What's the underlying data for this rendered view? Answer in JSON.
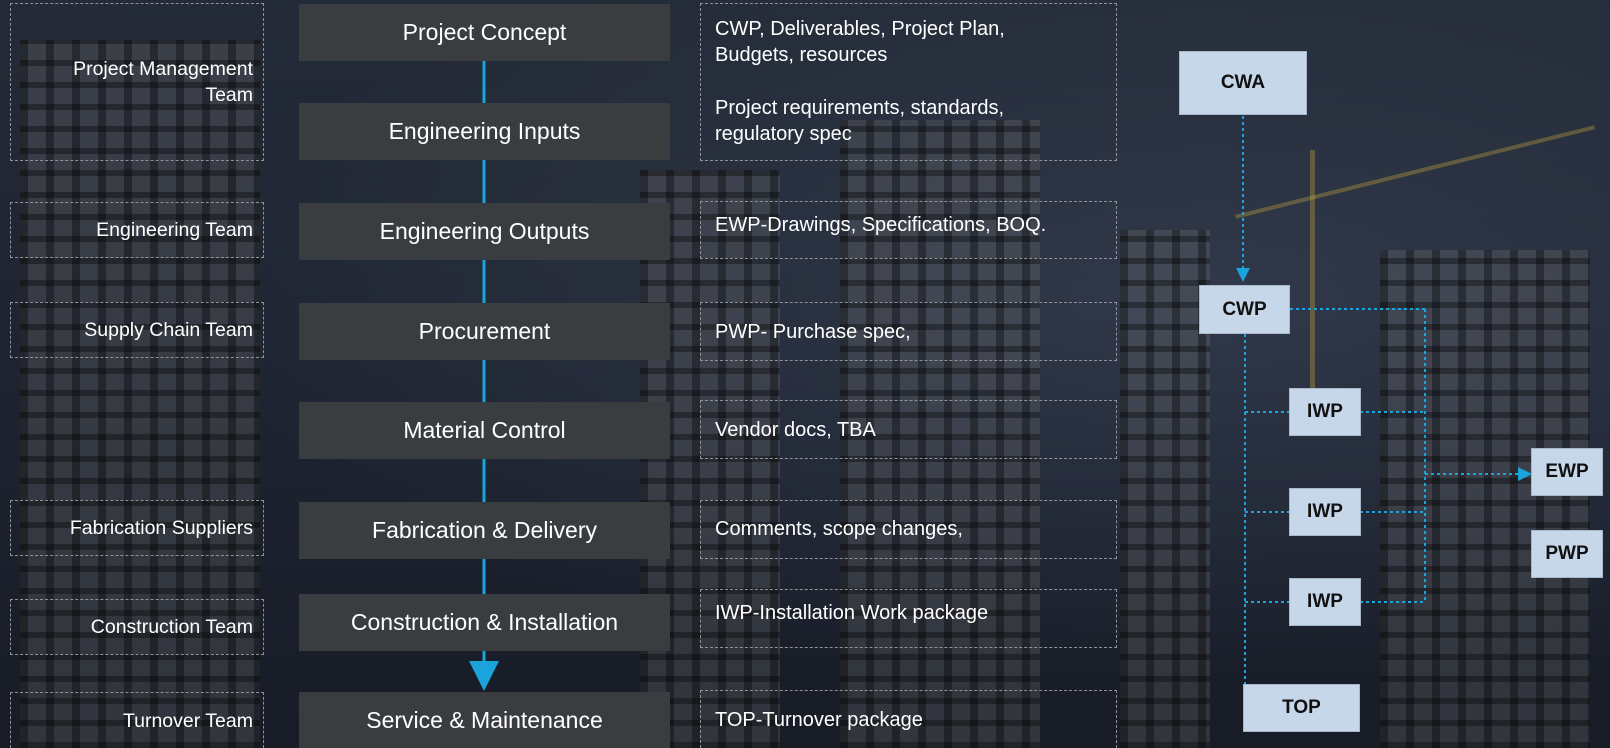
{
  "teams": [
    {
      "label": "Project Management Team"
    },
    {
      "label": "Engineering Team"
    },
    {
      "label": "Supply Chain Team"
    },
    {
      "label": "Fabrication Suppliers"
    },
    {
      "label": "Construction Team"
    },
    {
      "label": "Turnover Team"
    }
  ],
  "stages": [
    {
      "label": "Project Concept"
    },
    {
      "label": "Engineering Inputs"
    },
    {
      "label": "Engineering Outputs"
    },
    {
      "label": "Procurement"
    },
    {
      "label": "Material Control"
    },
    {
      "label": "Fabrication & Delivery"
    },
    {
      "label": "Construction & Installation"
    },
    {
      "label": "Service & Maintenance"
    }
  ],
  "deliverables": [
    {
      "line1": "CWP, Deliverables, Project Plan,",
      "line2": "Budgets, resources",
      "line3": "Project requirements, standards,",
      "line4": "regulatory spec"
    },
    {
      "line1": "EWP-Drawings, Specifications, BOQ."
    },
    {
      "line1": "PWP- Purchase spec,"
    },
    {
      "line1": "Vendor docs, TBA"
    },
    {
      "line1": "Comments, scope changes,"
    },
    {
      "line1": "IWP-Installation Work package"
    },
    {
      "line1": "TOP-Turnover package"
    }
  ],
  "packages": {
    "cwa": "CWA",
    "cwp": "CWP",
    "iwp": "IWP",
    "ewp": "EWP",
    "pwp": "PWP",
    "top": "TOP"
  },
  "colors": {
    "flow_line": "#1aa3dc",
    "stage_box": "#3a3d40",
    "package_box": "#c7d7ea"
  }
}
